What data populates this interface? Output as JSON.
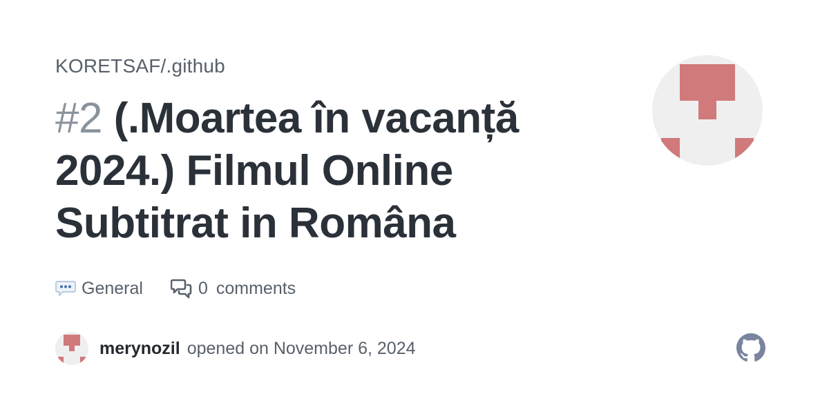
{
  "repo": "KORETSAF/.github",
  "issue": {
    "number": "#2",
    "title": "(.Moartea în vacanță 2024.) Filmul Online Subtitrat in Româna"
  },
  "meta": {
    "category_emoji_icon": "speech-balloon-dots-icon",
    "category": "General",
    "comments_count": "0",
    "comments_label": "comments"
  },
  "byline": {
    "user": "merynozil",
    "opened_text": "opened on November 6, 2024"
  },
  "colors": {
    "identicon": "#d07a7b",
    "avatar_bg": "#efeff0",
    "title": "#2b3139",
    "muted": "#57606a",
    "logo": "#7a84a0"
  },
  "icons": {
    "avatar": "identicon-avatar",
    "logo": "github-mark-icon",
    "comments": "comment-discussion-icon"
  }
}
